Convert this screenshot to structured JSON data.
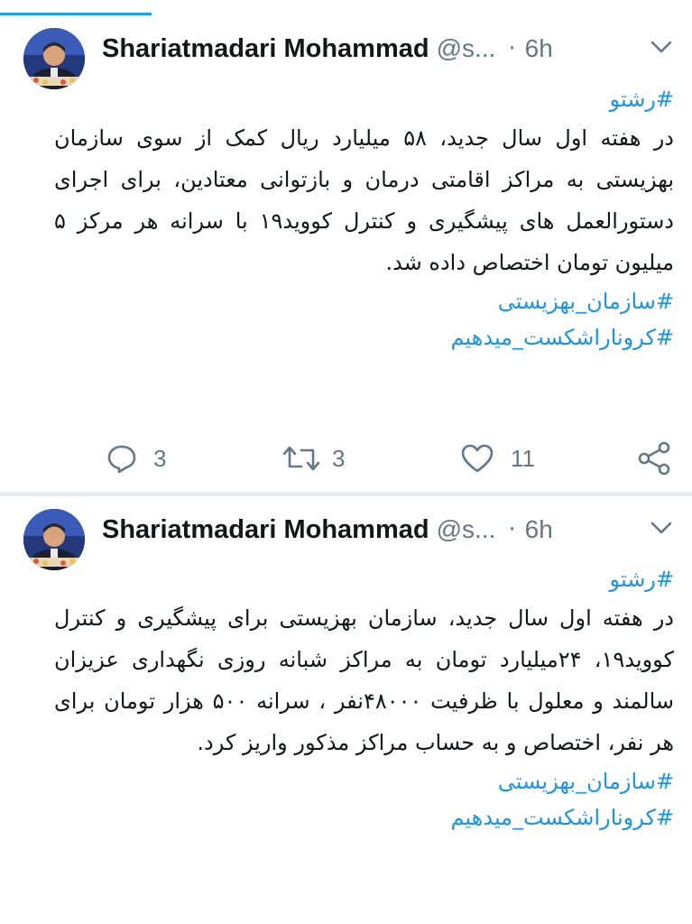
{
  "colors": {
    "accent": "#1da1f2",
    "hashtag": "#1b95e0",
    "text": "#14171a",
    "muted": "#657786",
    "divider": "#e6ecf0"
  },
  "tweets": [
    {
      "author_name": "Shariatmadari Mohammad",
      "handle": "@s...",
      "separator": "·",
      "time": "6h",
      "hashtag_top": "#رشتو",
      "text": "در هفته اول سال جدید، ۵۸ میلیارد ریال کمک از سوی سازمان بهزیستی به مراکز اقامتی درمان و بازتوانی معتادین، برای اجرای دستورالعمل های پیشگیری و کنترل کووید۱۹ با سرانه هر مرکز ۵ میلیون تومان اختصاص داده شد.",
      "hashtags_bottom": [
        "#سازمان_بهزیستی",
        "#کروناراشکست_میدهیم"
      ],
      "replies": "3",
      "retweets": "3",
      "likes": "11",
      "icons": [
        "reply-icon",
        "retweet-icon",
        "like-icon",
        "share-icon",
        "chevron-down-icon"
      ]
    },
    {
      "author_name": "Shariatmadari Mohammad",
      "handle": "@s...",
      "separator": "·",
      "time": "6h",
      "hashtag_top": "#رشتو",
      "text": "در هفته اول سال جدید، سازمان بهزیستی برای پیشگیری و کنترل کووید۱۹، ۲۴میلیارد تومان به مراکز شبانه روزی نگهداری عزیزان سالمند و معلول با ظرفیت ۴۸۰۰۰نفر ، سرانه ۵۰۰ هزار تومان برای هر نفر، اختصاص و به حساب مراکز مذکور واریز کرد.",
      "hashtags_bottom": [
        "#سازمان_بهزیستی",
        "#کروناراشکست_میدهیم"
      ],
      "icons": [
        "chevron-down-icon"
      ]
    }
  ]
}
